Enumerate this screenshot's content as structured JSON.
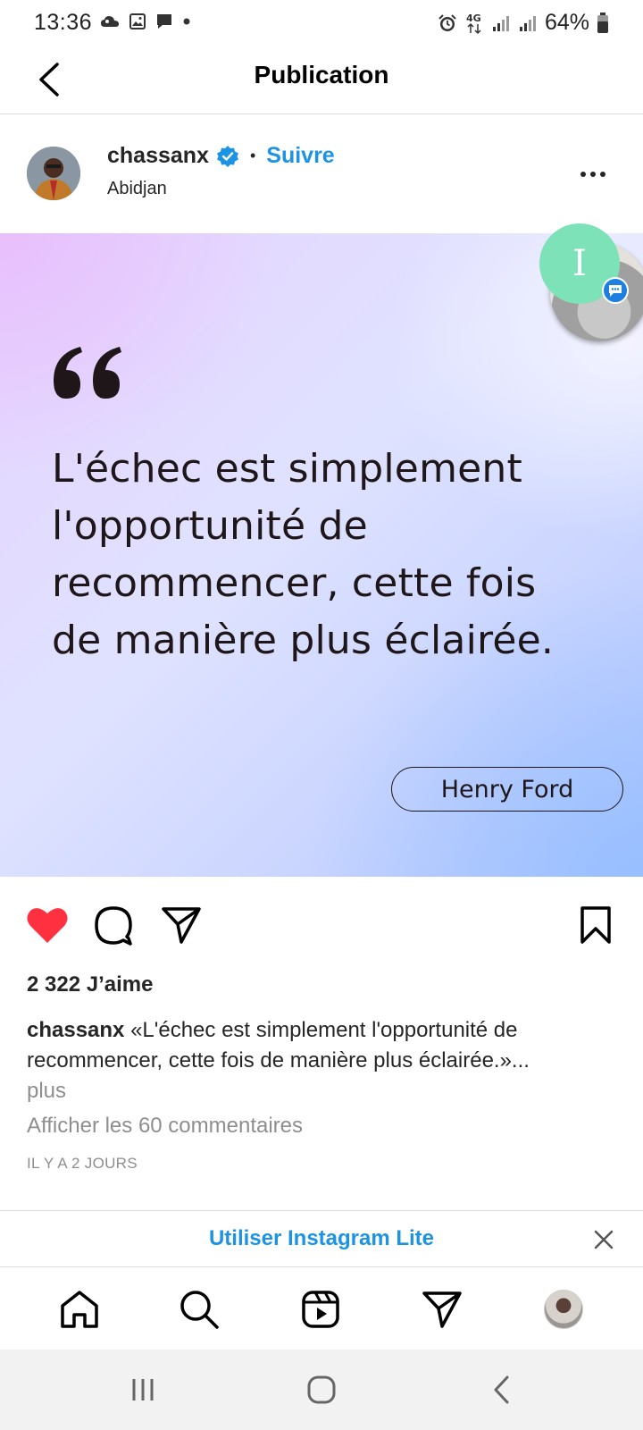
{
  "status_bar": {
    "time": "13:36",
    "battery": "64%",
    "network": "4G"
  },
  "header": {
    "title": "Publication"
  },
  "post": {
    "author": "chassanx",
    "verified": true,
    "follow_label": "Suivre",
    "location": "Abidjan",
    "image": {
      "quote": "L'échec est simplement l'opportunité de recommencer, cette fois de manière plus éclairée.",
      "quote_author": "Henry Ford"
    },
    "chat_head_initial": "I",
    "liked": true,
    "likes_label": "2 322 J’aime",
    "caption_user": "chassanx",
    "caption_text": "«L'échec est simplement l'opportunité de recommencer, cette fois de manière plus éclairée.»...",
    "caption_more": "plus",
    "comments_link": "Afficher les 60 commentaires",
    "date": "IL Y A 2 JOURS"
  },
  "banner": {
    "label": "Utiliser Instagram Lite"
  },
  "colors": {
    "link_blue": "#1d93e3",
    "like_red": "#ff3040",
    "verified_blue": "#1d93e3"
  },
  "icons": {
    "header": [
      "back-arrow-icon"
    ],
    "actions": [
      "heart-icon",
      "comment-icon",
      "share-icon",
      "bookmark-icon"
    ],
    "nav": [
      "home-icon",
      "search-icon",
      "reels-icon",
      "direct-icon",
      "profile-avatar"
    ],
    "system": [
      "recents-icon",
      "home-circle-icon",
      "system-back-icon"
    ]
  }
}
